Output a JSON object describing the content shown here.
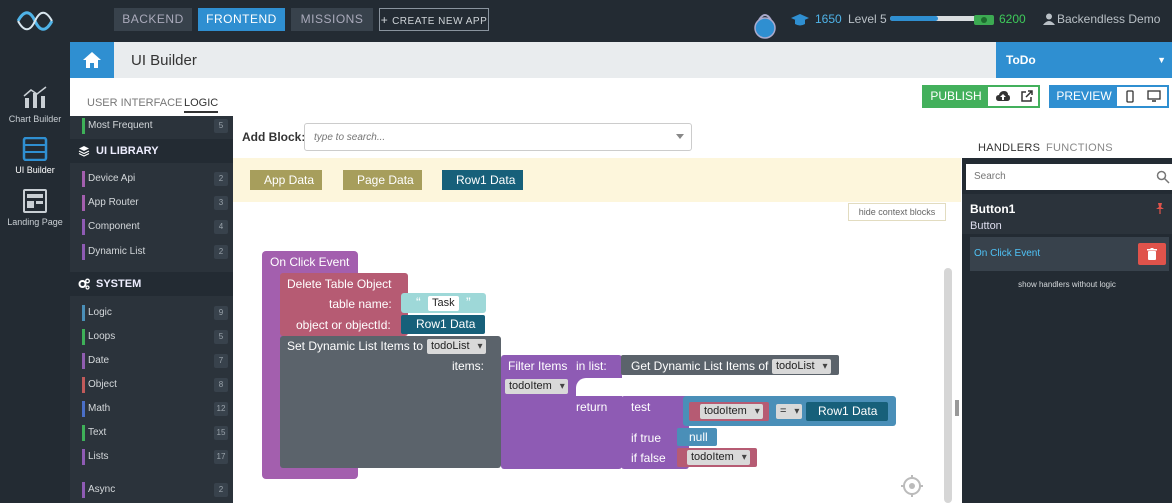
{
  "topbar": {
    "nav": [
      {
        "label": "BACKEND"
      },
      {
        "label": "FRONTEND"
      },
      {
        "label": "MISSIONS"
      },
      {
        "label": "CREATE NEW APP"
      }
    ],
    "points": "1650",
    "level": "Level 5",
    "xp_progress": 0.5,
    "coins": "6200",
    "user": "Backendless Demo"
  },
  "rail": [
    {
      "label": "Chart Builder",
      "icon": "chart-icon"
    },
    {
      "label": "UI Builder",
      "icon": "ui-builder-icon"
    },
    {
      "label": "Landing Page",
      "icon": "landing-page-icon"
    }
  ],
  "header": {
    "title": "UI Builder",
    "app": "ToDo"
  },
  "subtabs": {
    "user_interface": "USER INTERFACE",
    "logic": "LOGIC",
    "publish": "PUBLISH",
    "preview": "PREVIEW"
  },
  "library": {
    "most_frequent": {
      "label": "Most Frequent",
      "count": "5"
    },
    "ui_library": "UI LIBRARY",
    "ui_items": [
      {
        "label": "Device Api",
        "count": "2"
      },
      {
        "label": "App Router",
        "count": "3"
      },
      {
        "label": "Component",
        "count": "4"
      },
      {
        "label": "Dynamic List",
        "count": "2"
      }
    ],
    "system": "SYSTEM",
    "system_items": [
      {
        "label": "Logic",
        "count": "9"
      },
      {
        "label": "Loops",
        "count": "5"
      },
      {
        "label": "Date",
        "count": "7"
      },
      {
        "label": "Object",
        "count": "8"
      },
      {
        "label": "Math",
        "count": "12"
      },
      {
        "label": "Text",
        "count": "15"
      },
      {
        "label": "Lists",
        "count": "17"
      },
      {
        "label": "Async",
        "count": "2"
      }
    ]
  },
  "add_block": {
    "label": "Add Block:",
    "placeholder": "type to search..."
  },
  "context_blocks": [
    "App Data",
    "Page Data",
    "Row1 Data"
  ],
  "hide_context": "hide context blocks",
  "blocks": {
    "event": "On Click Event",
    "delete": "Delete Table Object",
    "table_name_label": "table name:",
    "table_name_value": "Task",
    "object_label": "object or objectId:",
    "object_value": "Row1 Data",
    "set_list": "Set Dynamic List Items to",
    "set_list_dd": "todoList",
    "items_label": "items:",
    "filter": "Filter Items",
    "in_list": "in list:",
    "get_items": "Get Dynamic List Items of",
    "get_items_dd": "todoList",
    "filter_var": "todoItem",
    "return": "return",
    "test": "test",
    "test_var": "todoItem",
    "eq": "=",
    "test_value": "Row1 Data",
    "if_true": "if true",
    "null": "null",
    "if_false": "if false",
    "false_var": "todoItem"
  },
  "handlers": {
    "tab_handlers": "HANDLERS",
    "tab_functions": "FUNCTIONS",
    "search_placeholder": "Search",
    "component_name": "Button1",
    "component_type": "Button",
    "event": "On Click Event",
    "show_without_logic": "show handlers without logic"
  },
  "colors": {
    "accent": "#2f8fd1",
    "publish": "#43b05c",
    "event_block": "#a35fae",
    "data_block": "#a79e5c",
    "row_block": "#17607a",
    "delete_block": "#b65b73",
    "list_block": "#5b636b",
    "filter_block": "#8e5bb4"
  }
}
